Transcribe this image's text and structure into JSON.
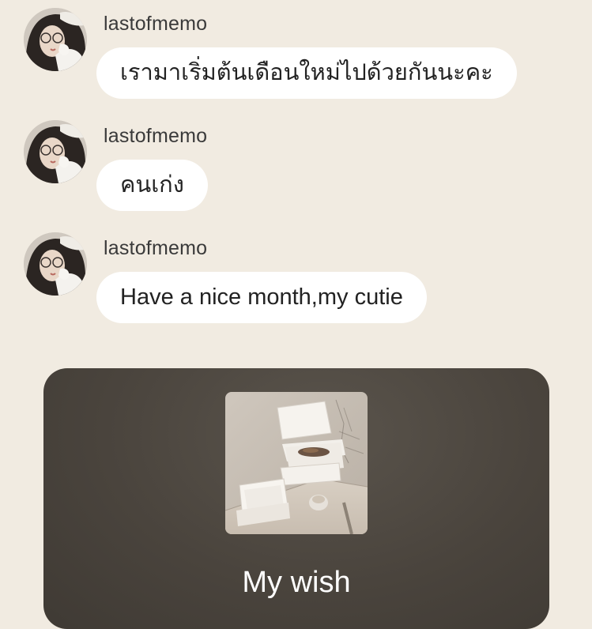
{
  "messages": [
    {
      "username": "lastofmemo",
      "text": "เรามาเริ่มต้นเดือนใหม่ไปด้วยกันนะคะ"
    },
    {
      "username": "lastofmemo",
      "text": "คนเก่ง"
    },
    {
      "username": "lastofmemo",
      "text": "Have a nice month,my cutie"
    }
  ],
  "card": {
    "title": "My wish"
  },
  "colors": {
    "background": "#f1ebe1",
    "bubble": "#ffffff",
    "card": "#4a443d"
  }
}
